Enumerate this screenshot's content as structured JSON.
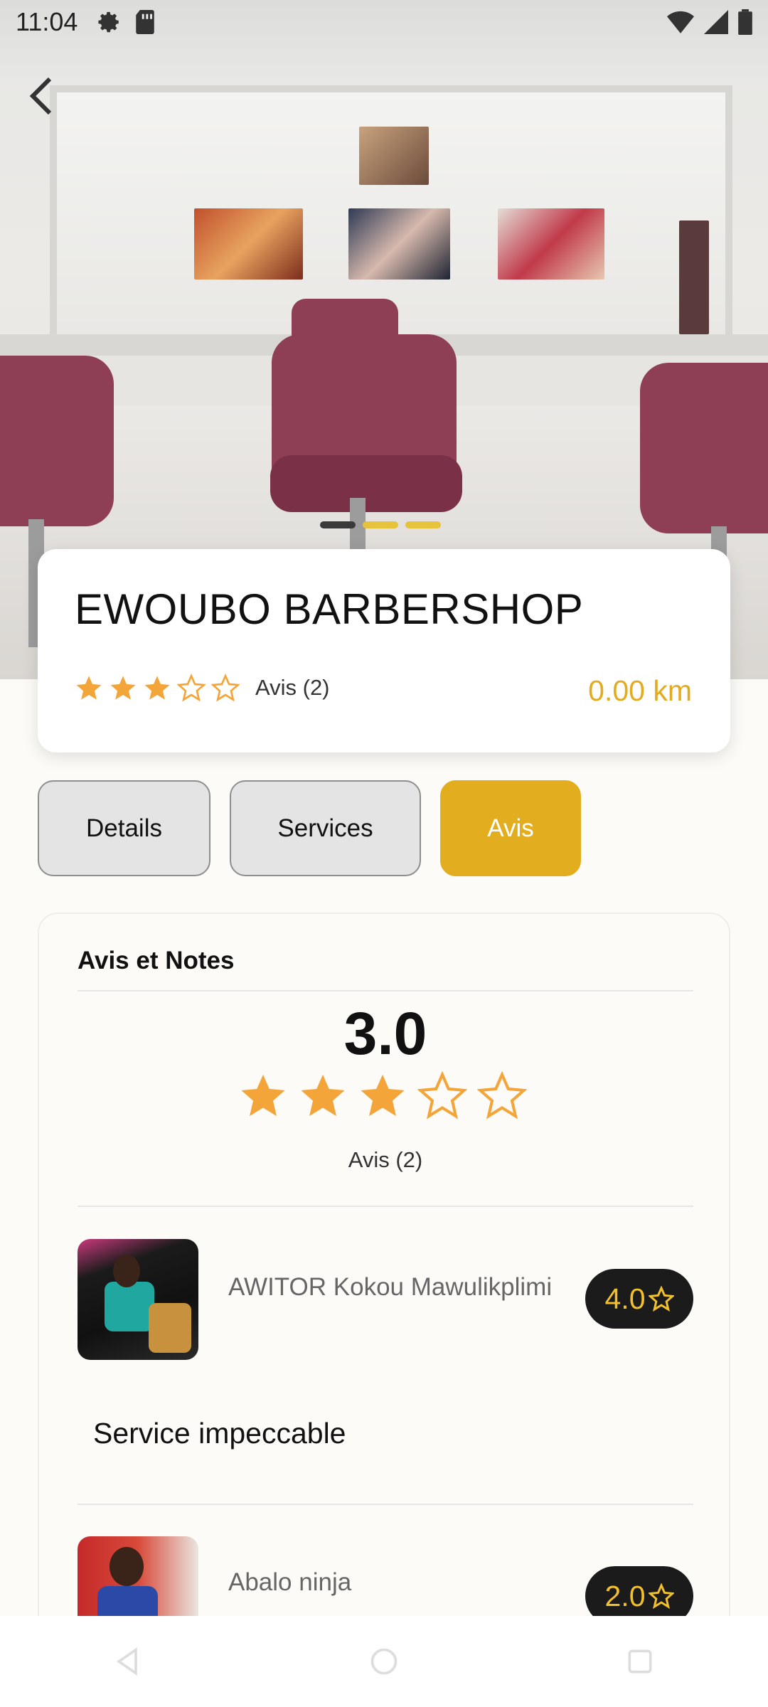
{
  "status_bar": {
    "time": "11:04",
    "left_icons": [
      "gear-icon",
      "sim-card-icon"
    ],
    "right_icons": [
      "wifi-icon",
      "cell-signal-icon",
      "battery-icon"
    ]
  },
  "hero": {
    "image": "barbershop-interior-photo",
    "carousel_count": 3,
    "carousel_active_index": 0
  },
  "shop": {
    "name": "EWOUBO BARBERSHOP",
    "rating": 3,
    "rating_max": 5,
    "reviews_label": "Avis (2)",
    "distance": "0.00 km"
  },
  "tabs": [
    {
      "label": "Details",
      "active": false
    },
    {
      "label": "Services",
      "active": false
    },
    {
      "label": "Avis",
      "active": true
    }
  ],
  "reviews_section": {
    "title": "Avis et Notes",
    "average": "3.0",
    "average_stars": 3,
    "count_label": "Avis (2)",
    "items": [
      {
        "name": "AWITOR Kokou Mawulikplimi",
        "score": "4.0",
        "comment": "Service impeccable"
      },
      {
        "name": "Abalo ninja",
        "score": "2.0",
        "comment": ""
      }
    ]
  },
  "colors": {
    "accent": "#e2ad1e",
    "star": "#f4a53a",
    "badge_bg": "#1b1b1b",
    "badge_text": "#f1c02a"
  }
}
